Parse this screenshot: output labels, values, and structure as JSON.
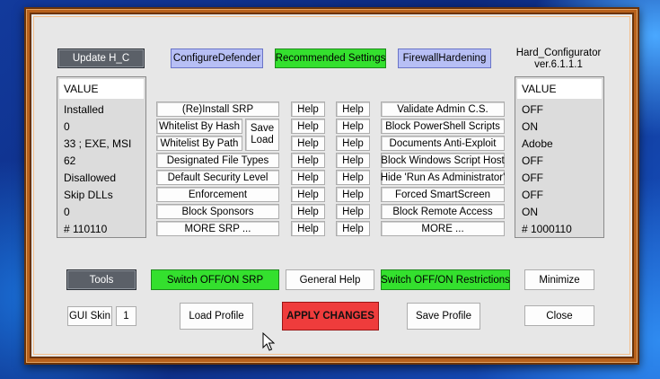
{
  "app": {
    "title_line1": "Hard_Configurator",
    "title_line2": "ver.6.1.1.1"
  },
  "top_buttons": {
    "update": "Update H_C",
    "configure_defender": "ConfigureDefender",
    "recommended": "Recommended Settings",
    "firewall": "FirewallHardening"
  },
  "left_panel": {
    "header": "VALUE",
    "rows": [
      "Installed",
      "0",
      "33 ;  EXE, MSI",
      "62",
      "Disallowed",
      "Skip DLLs",
      "0",
      "# 110110"
    ]
  },
  "right_panel": {
    "header": "VALUE",
    "rows": [
      "OFF",
      "ON",
      "Adobe",
      "OFF",
      "OFF",
      "OFF",
      "ON",
      "# 1000110"
    ]
  },
  "srp_buttons": [
    "(Re)Install SRP",
    "Whitelist By Hash",
    "Whitelist By Path",
    "Designated File Types",
    "Default Security Level",
    "Enforcement",
    "Block Sponsors",
    "MORE SRP ..."
  ],
  "save_load": {
    "save": "Save",
    "load": "Load"
  },
  "help_label": "Help",
  "restriction_buttons": [
    "Validate Admin C.S.",
    "Block PowerShell Scripts",
    "Documents Anti-Exploit",
    "Block Windows Script Host",
    "Hide  'Run As Administrator'",
    "Forced SmartScreen",
    "Block Remote Access",
    "MORE ..."
  ],
  "bottom": {
    "tools": "Tools",
    "switch_srp": "Switch OFF/ON SRP",
    "general_help": "General Help",
    "switch_restrictions": "Switch OFF/ON Restrictions",
    "minimize": "Minimize",
    "gui_skin_label": "GUI Skin",
    "gui_skin_value": "1",
    "load_profile": "Load Profile",
    "apply_changes": "APPLY CHANGES",
    "save_profile": "Save Profile",
    "close": "Close"
  }
}
